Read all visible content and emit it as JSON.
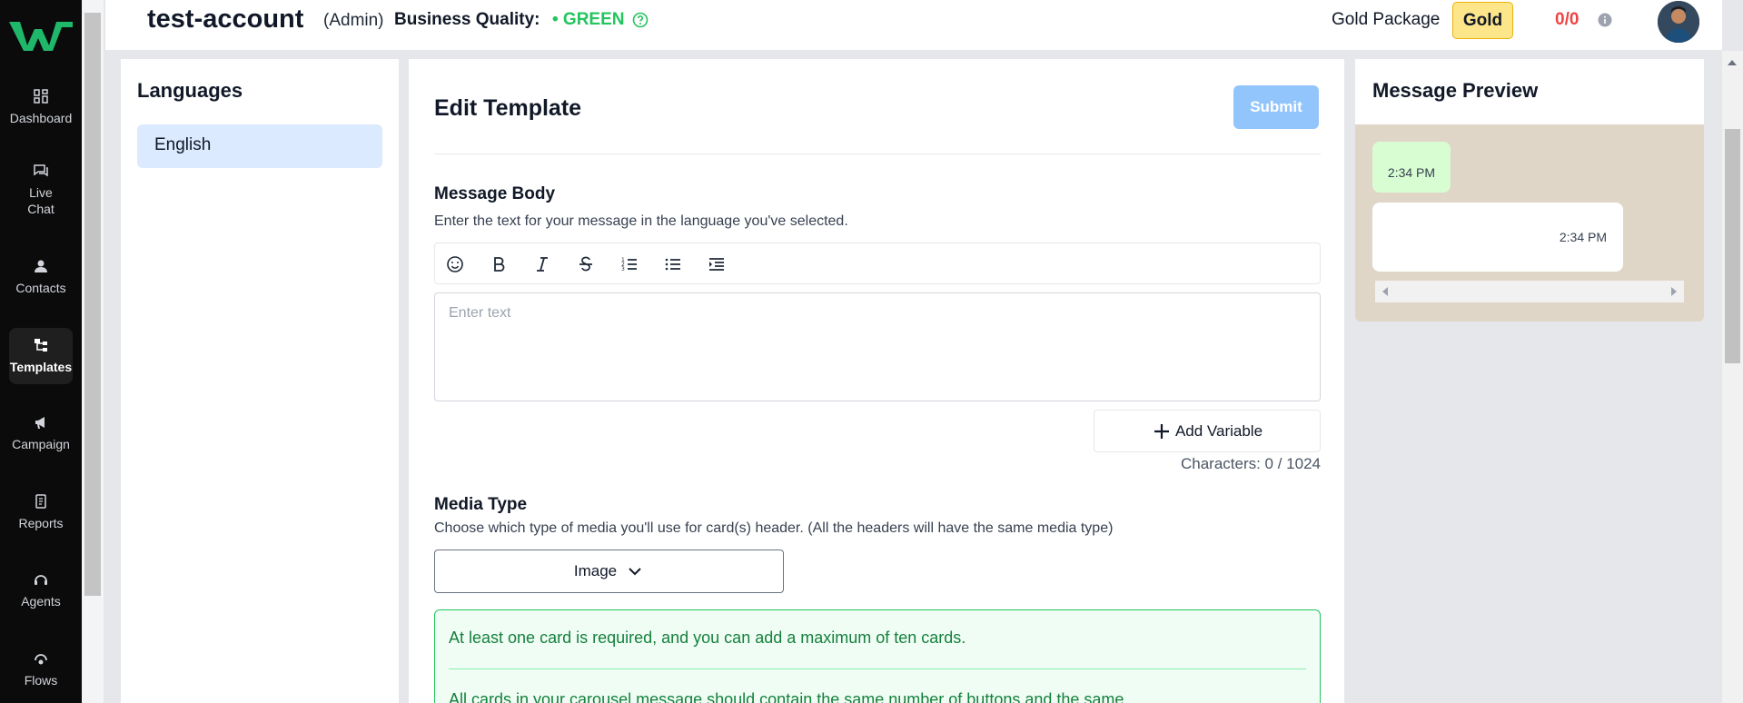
{
  "sidebar": {
    "items": [
      {
        "label": "Dashboard",
        "icon": "dashboard-icon"
      },
      {
        "label": "Live\nChat",
        "icon": "chat-icon"
      },
      {
        "label": "Contacts",
        "icon": "user-icon"
      },
      {
        "label": "Templates",
        "icon": "templates-icon",
        "active": true
      },
      {
        "label": "Campaign",
        "icon": "megaphone-icon"
      },
      {
        "label": "Reports",
        "icon": "reports-icon"
      },
      {
        "label": "Agents",
        "icon": "headset-icon"
      },
      {
        "label": "Flows",
        "icon": "flows-icon"
      }
    ]
  },
  "header": {
    "account_name": "test-account",
    "role": "(Admin)",
    "quality_label": "Business Quality:",
    "quality_value": "• GREEN",
    "package_label": "Gold Package",
    "package_badge": "Gold",
    "counter": "0/0"
  },
  "languages": {
    "title": "Languages",
    "items": [
      "English"
    ]
  },
  "editor": {
    "title": "Edit Template",
    "submit_label": "Submit",
    "message_body": {
      "label": "Message Body",
      "description": "Enter the text for your message in the language you've selected.",
      "placeholder": "Enter text",
      "add_variable_label": "Add Variable",
      "characters": "Characters: 0 / 1024"
    },
    "media_type": {
      "label": "Media Type",
      "description": "Choose which type of media you'll use for card(s) header. (All the headers will have the same media type)",
      "selected": "Image"
    },
    "info": {
      "line1": "At least one card is required, and you can add a maximum of ten cards.",
      "line2": "All cards in your carousel message should contain the same number of buttons and the same"
    }
  },
  "preview": {
    "title": "Message Preview",
    "bubble1_time": "2:34 PM",
    "bubble2_time": "2:34 PM"
  },
  "colors": {
    "quality_green": "#22c55e",
    "counter_red": "#ef4444",
    "gold_badge": "#fde68a",
    "submit_blue": "#93c5fd"
  }
}
